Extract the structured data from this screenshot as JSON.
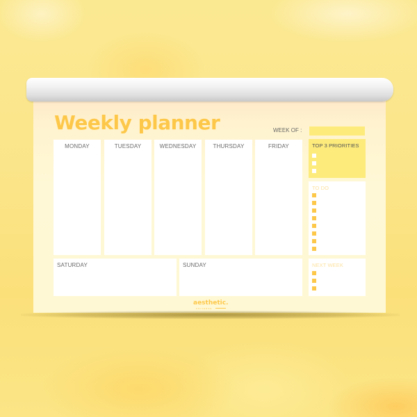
{
  "planner": {
    "title": "Weekly planner",
    "week_of_label": "WEEK OF :",
    "week_of_value": "",
    "weekdays": [
      "MONDAY",
      "TUESDAY",
      "WEDNESDAY",
      "THURSDAY",
      "FRIDAY"
    ],
    "weekend": [
      "SATURDAY",
      "SUNDAY"
    ],
    "priorities": {
      "title": "TOP 3 PRIORITIES",
      "checkbox_count": 3
    },
    "todo": {
      "title": "TO DO",
      "checkbox_count": 8
    },
    "next_week": {
      "title": "NEXT WEEK",
      "checkbox_count": 3
    },
    "brand": {
      "logo_text": "aesthetic.",
      "tagline": "UNIVERSE"
    }
  },
  "colors": {
    "accent": "#fdc84a",
    "highlight": "#fdeb7c",
    "paper": "#fff8d4",
    "box": "#ffffff",
    "label_gray": "#6a6a6a",
    "faint_label": "#fde2a0"
  }
}
